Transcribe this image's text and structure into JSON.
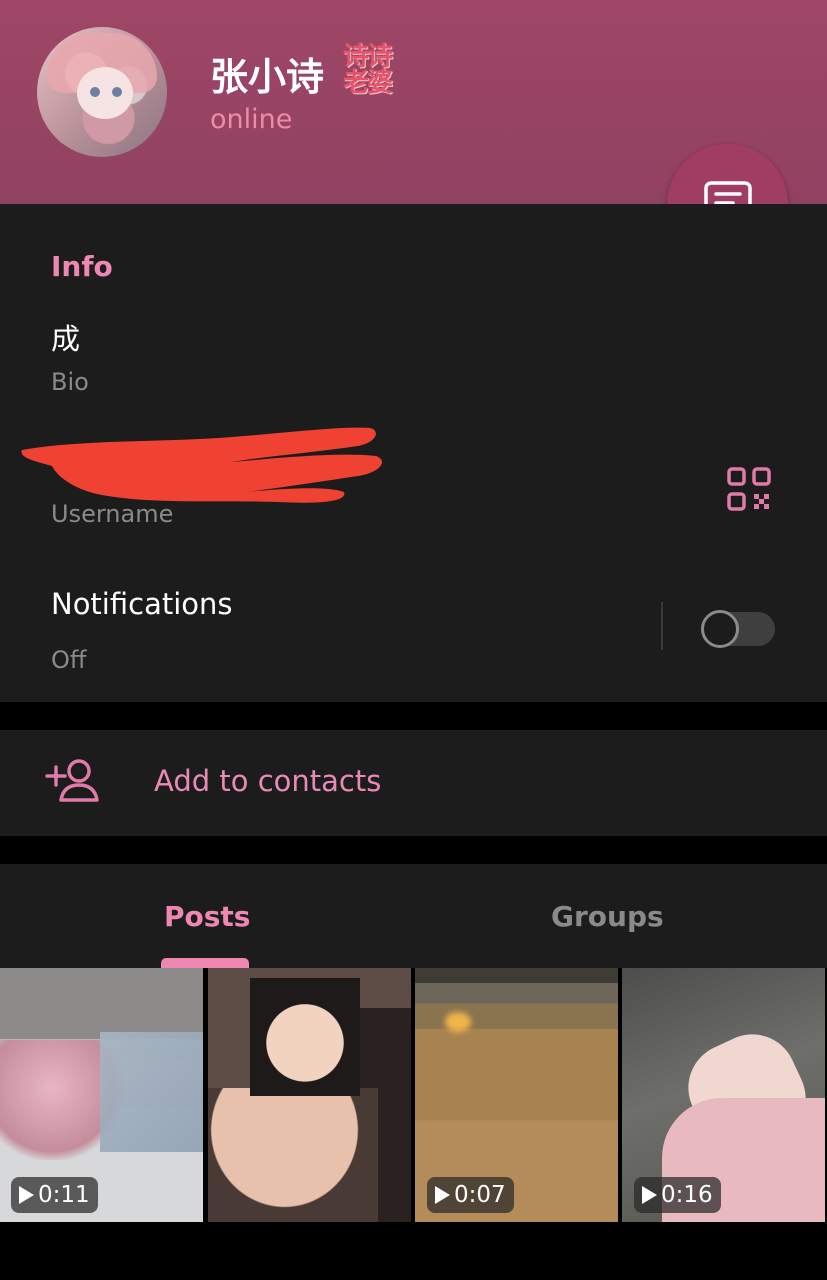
{
  "profile": {
    "name": "张小诗",
    "status": "online",
    "sticker_text": "诗诗老婆"
  },
  "info": {
    "section_title": "Info",
    "bio_value": "成",
    "bio_caption": "Bio",
    "username_caption": "Username",
    "notifications_value": "Notifications",
    "notifications_caption": "Off",
    "notifications_enabled": false
  },
  "actions": {
    "add_contacts_label": "Add to contacts"
  },
  "tabs": [
    {
      "label": "Posts",
      "selected": true
    },
    {
      "label": "Groups",
      "selected": false
    }
  ],
  "media": [
    {
      "duration": "0:11",
      "type": "video"
    },
    {
      "duration": "",
      "type": "image"
    },
    {
      "duration": "0:07",
      "type": "video"
    },
    {
      "duration": "0:16",
      "type": "video"
    }
  ],
  "colors": {
    "header": "#9c4565",
    "accent": "#ee87b2",
    "fab": "#a13c62",
    "card": "#1c1c1c"
  },
  "icons": [
    "message-icon",
    "qr-code-icon",
    "add-contact-icon",
    "play-icon"
  ]
}
